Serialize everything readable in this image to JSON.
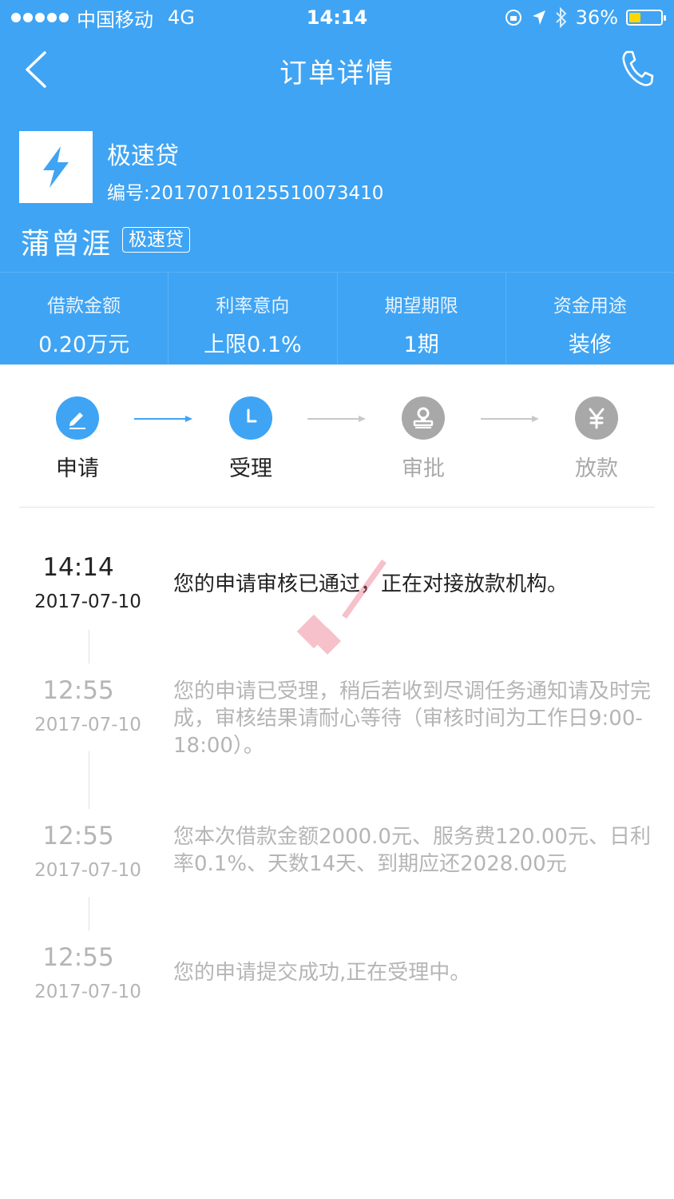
{
  "status_bar": {
    "carrier": "中国移动",
    "network": "4G",
    "time": "14:14",
    "battery": "36%",
    "battery_level": 0.36
  },
  "nav": {
    "title": "订单详情"
  },
  "product": {
    "name": "极速贷",
    "id_label": "编号:20170710125510073410",
    "person": "蒲曾涯",
    "tag": "极速贷"
  },
  "stats": [
    {
      "label": "借款金额",
      "value": "0.20万元"
    },
    {
      "label": "利率意向",
      "value": "上限0.1%"
    },
    {
      "label": "期望期限",
      "value": "1期"
    },
    {
      "label": "资金用途",
      "value": "装修"
    }
  ],
  "steps": [
    {
      "label": "申请",
      "state": "active",
      "icon": "pencil-icon"
    },
    {
      "label": "受理",
      "state": "active",
      "icon": "clock-icon"
    },
    {
      "label": "审批",
      "state": "inactive",
      "icon": "stamp-icon"
    },
    {
      "label": "放款",
      "state": "inactive",
      "icon": "yen-icon"
    }
  ],
  "timeline": [
    {
      "time": "14:14",
      "date": "2017-07-10",
      "text": "您的申请审核已通过，正在对接放款机构。",
      "state": "current"
    },
    {
      "time": "12:55",
      "date": "2017-07-10",
      "text": "您的申请已受理，稍后若收到尽调任务通知请及时完成，审核结果请耐心等待（审核时间为工作日9:00-18:00）。",
      "state": "past"
    },
    {
      "time": "12:55",
      "date": "2017-07-10",
      "text": "您本次借款金额2000.0元、服务费120.00元、日利率0.1%、天数14天、到期应还2028.00元",
      "state": "past"
    },
    {
      "time": "12:55",
      "date": "2017-07-10",
      "text": "您的申请提交成功,正在受理中。",
      "state": "past"
    }
  ],
  "colors": {
    "brand": "#3fa4f4",
    "inactive": "#a8a8a8",
    "battery": "#ffd700"
  }
}
